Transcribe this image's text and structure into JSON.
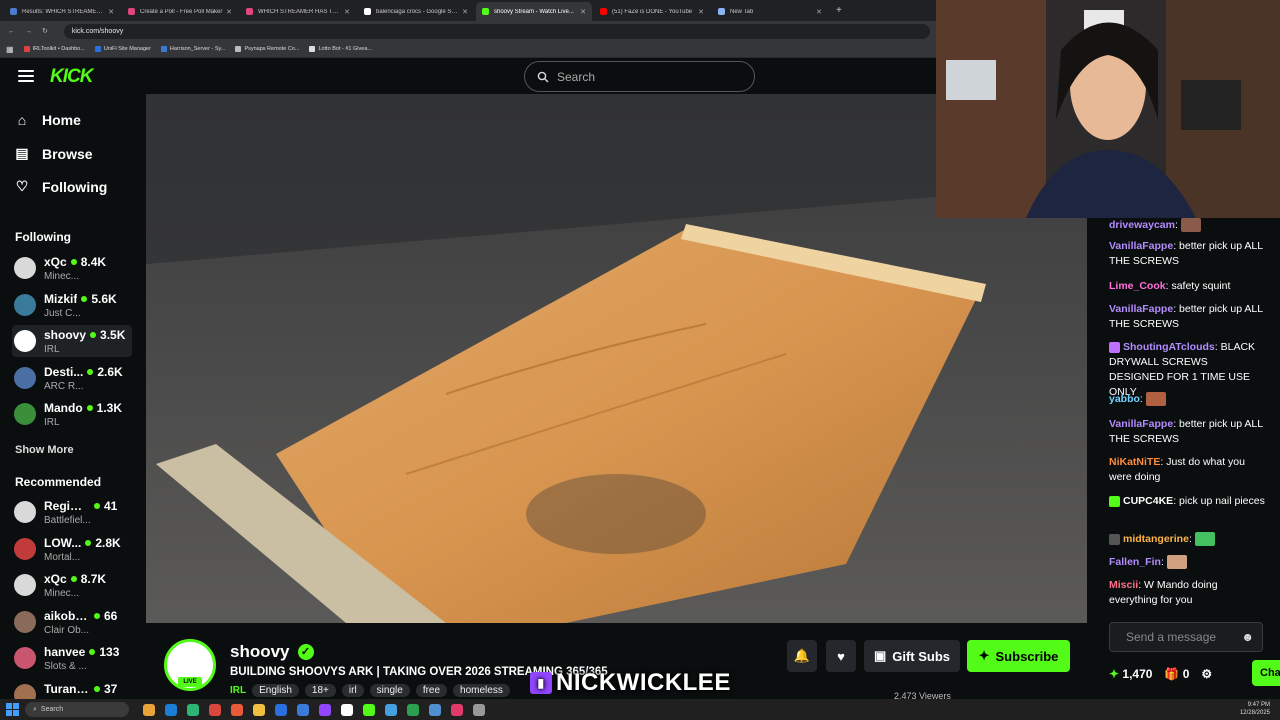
{
  "browser": {
    "tabs": [
      {
        "label": "Results: WHICH STREAMER HA...",
        "color": "#4a7bd0"
      },
      {
        "label": "Create a Poll - Free Poll Maker",
        "color": "#e0457b"
      },
      {
        "label": "WHICH STREAMER HAS THE BE...",
        "color": "#e0457b"
      },
      {
        "label": "balenciaga crocs - Google Sear...",
        "color": "#ffffff"
      },
      {
        "label": "shoovy Stream - Watch Live...",
        "color": "#53fc18"
      },
      {
        "label": "(51) FaZe is DONE - YouTube",
        "color": "#ff0000"
      },
      {
        "label": "New Tab",
        "color": "#8ab4f8"
      }
    ],
    "url": "kick.com/shoovy",
    "bookmarks": [
      "IRLToolkit • Dashbo...",
      "UniFi Site Manager",
      "Harrison_Server - Sy...",
      "Psynaps Remote Co...",
      "Lotto Bot - #1 Givea..."
    ]
  },
  "kick": {
    "logo": "KICK",
    "search_placeholder": "Search",
    "nav": {
      "home": "Home",
      "browse": "Browse",
      "following": "Following"
    },
    "following_header": "Following",
    "recommended_header": "Recommended",
    "show_more": "Show More",
    "following": [
      {
        "name": "xQc",
        "viewers": "8.4K",
        "category": "Minec...",
        "color": "#d9d9d9"
      },
      {
        "name": "Mizkif",
        "viewers": "5.6K",
        "category": "Just C...",
        "color": "#3a7a9a"
      },
      {
        "name": "shoovy",
        "viewers": "3.5K",
        "category": "IRL",
        "color": "#ffffff"
      },
      {
        "name": "Desti...",
        "viewers": "2.6K",
        "category": "ARC R...",
        "color": "#4a6fa5"
      },
      {
        "name": "Mando",
        "viewers": "1.3K",
        "category": "IRL",
        "color": "#3b8f3b"
      }
    ],
    "recommended": [
      {
        "name": "Regime...",
        "viewers": "41",
        "category": "Battlefiel...",
        "color": "#d9d9d9"
      },
      {
        "name": "LOW...",
        "viewers": "2.8K",
        "category": "Mortal...",
        "color": "#c23b3b"
      },
      {
        "name": "xQc",
        "viewers": "8.7K",
        "category": "Minec...",
        "color": "#d9d9d9"
      },
      {
        "name": "aikobliss",
        "viewers": "66",
        "category": "Clair Ob...",
        "color": "#8a6a5a"
      },
      {
        "name": "hanvee",
        "viewers": "133",
        "category": "Slots & ...",
        "color": "#c9556f"
      },
      {
        "name": "TuranS...",
        "viewers": "37",
        "category": "",
        "color": "#a07050"
      }
    ]
  },
  "chat": {
    "messages": [
      {
        "user": "drivewaycam",
        "user_color": "#b38cff",
        "text": ""
      },
      {
        "user": "VanillaFappe",
        "user_color": "#b38cff",
        "text": "better pick up ALL THE SCREWS"
      },
      {
        "user": "Lime_Cook",
        "user_color": "#ff6fd8",
        "text": "safety squint"
      },
      {
        "user": "VanillaFappe",
        "user_color": "#b38cff",
        "text": "better pick up ALL THE SCREWS"
      },
      {
        "user": "ShoutingATclouds",
        "user_color": "#b38cff",
        "text": "BLACK DRYWALL SCREWS DESIGNED FOR 1 TIME USE ONLY"
      },
      {
        "user": "yabbo",
        "user_color": "#6fd3ff",
        "text": ""
      },
      {
        "user": "VanillaFappe",
        "user_color": "#b38cff",
        "text": "better pick up ALL THE SCREWS"
      },
      {
        "user": "NiKatNiTE",
        "user_color": "#ff8c3a",
        "text": "Just do what you were doing"
      },
      {
        "user": "CUPC4KE",
        "user_color": "#ffffff",
        "text": "pick up nail pieces"
      },
      {
        "user": "midtangerine",
        "user_color": "#ffb347",
        "text": ""
      },
      {
        "user": "Fallen_Fin",
        "user_color": "#b38cff",
        "text": ""
      },
      {
        "user": "Miscii",
        "user_color": "#ff6f8a",
        "text": "W Mando doing everything for you"
      }
    ],
    "input_placeholder": "Send a message",
    "points": "1,470",
    "gifts": "0",
    "chat_button": "Cha"
  },
  "stream": {
    "name": "shoovy",
    "live_label": "LIVE",
    "title": "BUILDING SHOOVYS ARK | TAKING OVER 2026 STREAMING 365/365",
    "category": "IRL",
    "tags": [
      "English",
      "18+",
      "irl",
      "single",
      "free",
      "homeless"
    ],
    "viewers": "2,473 Viewers",
    "gift_subs": "Gift Subs",
    "subscribe": "Subscribe",
    "overlay_name": "NICKWICKLEE"
  },
  "taskbar": {
    "search_placeholder": "Search",
    "time": "9:47 PM",
    "date": "12/28/2025"
  }
}
